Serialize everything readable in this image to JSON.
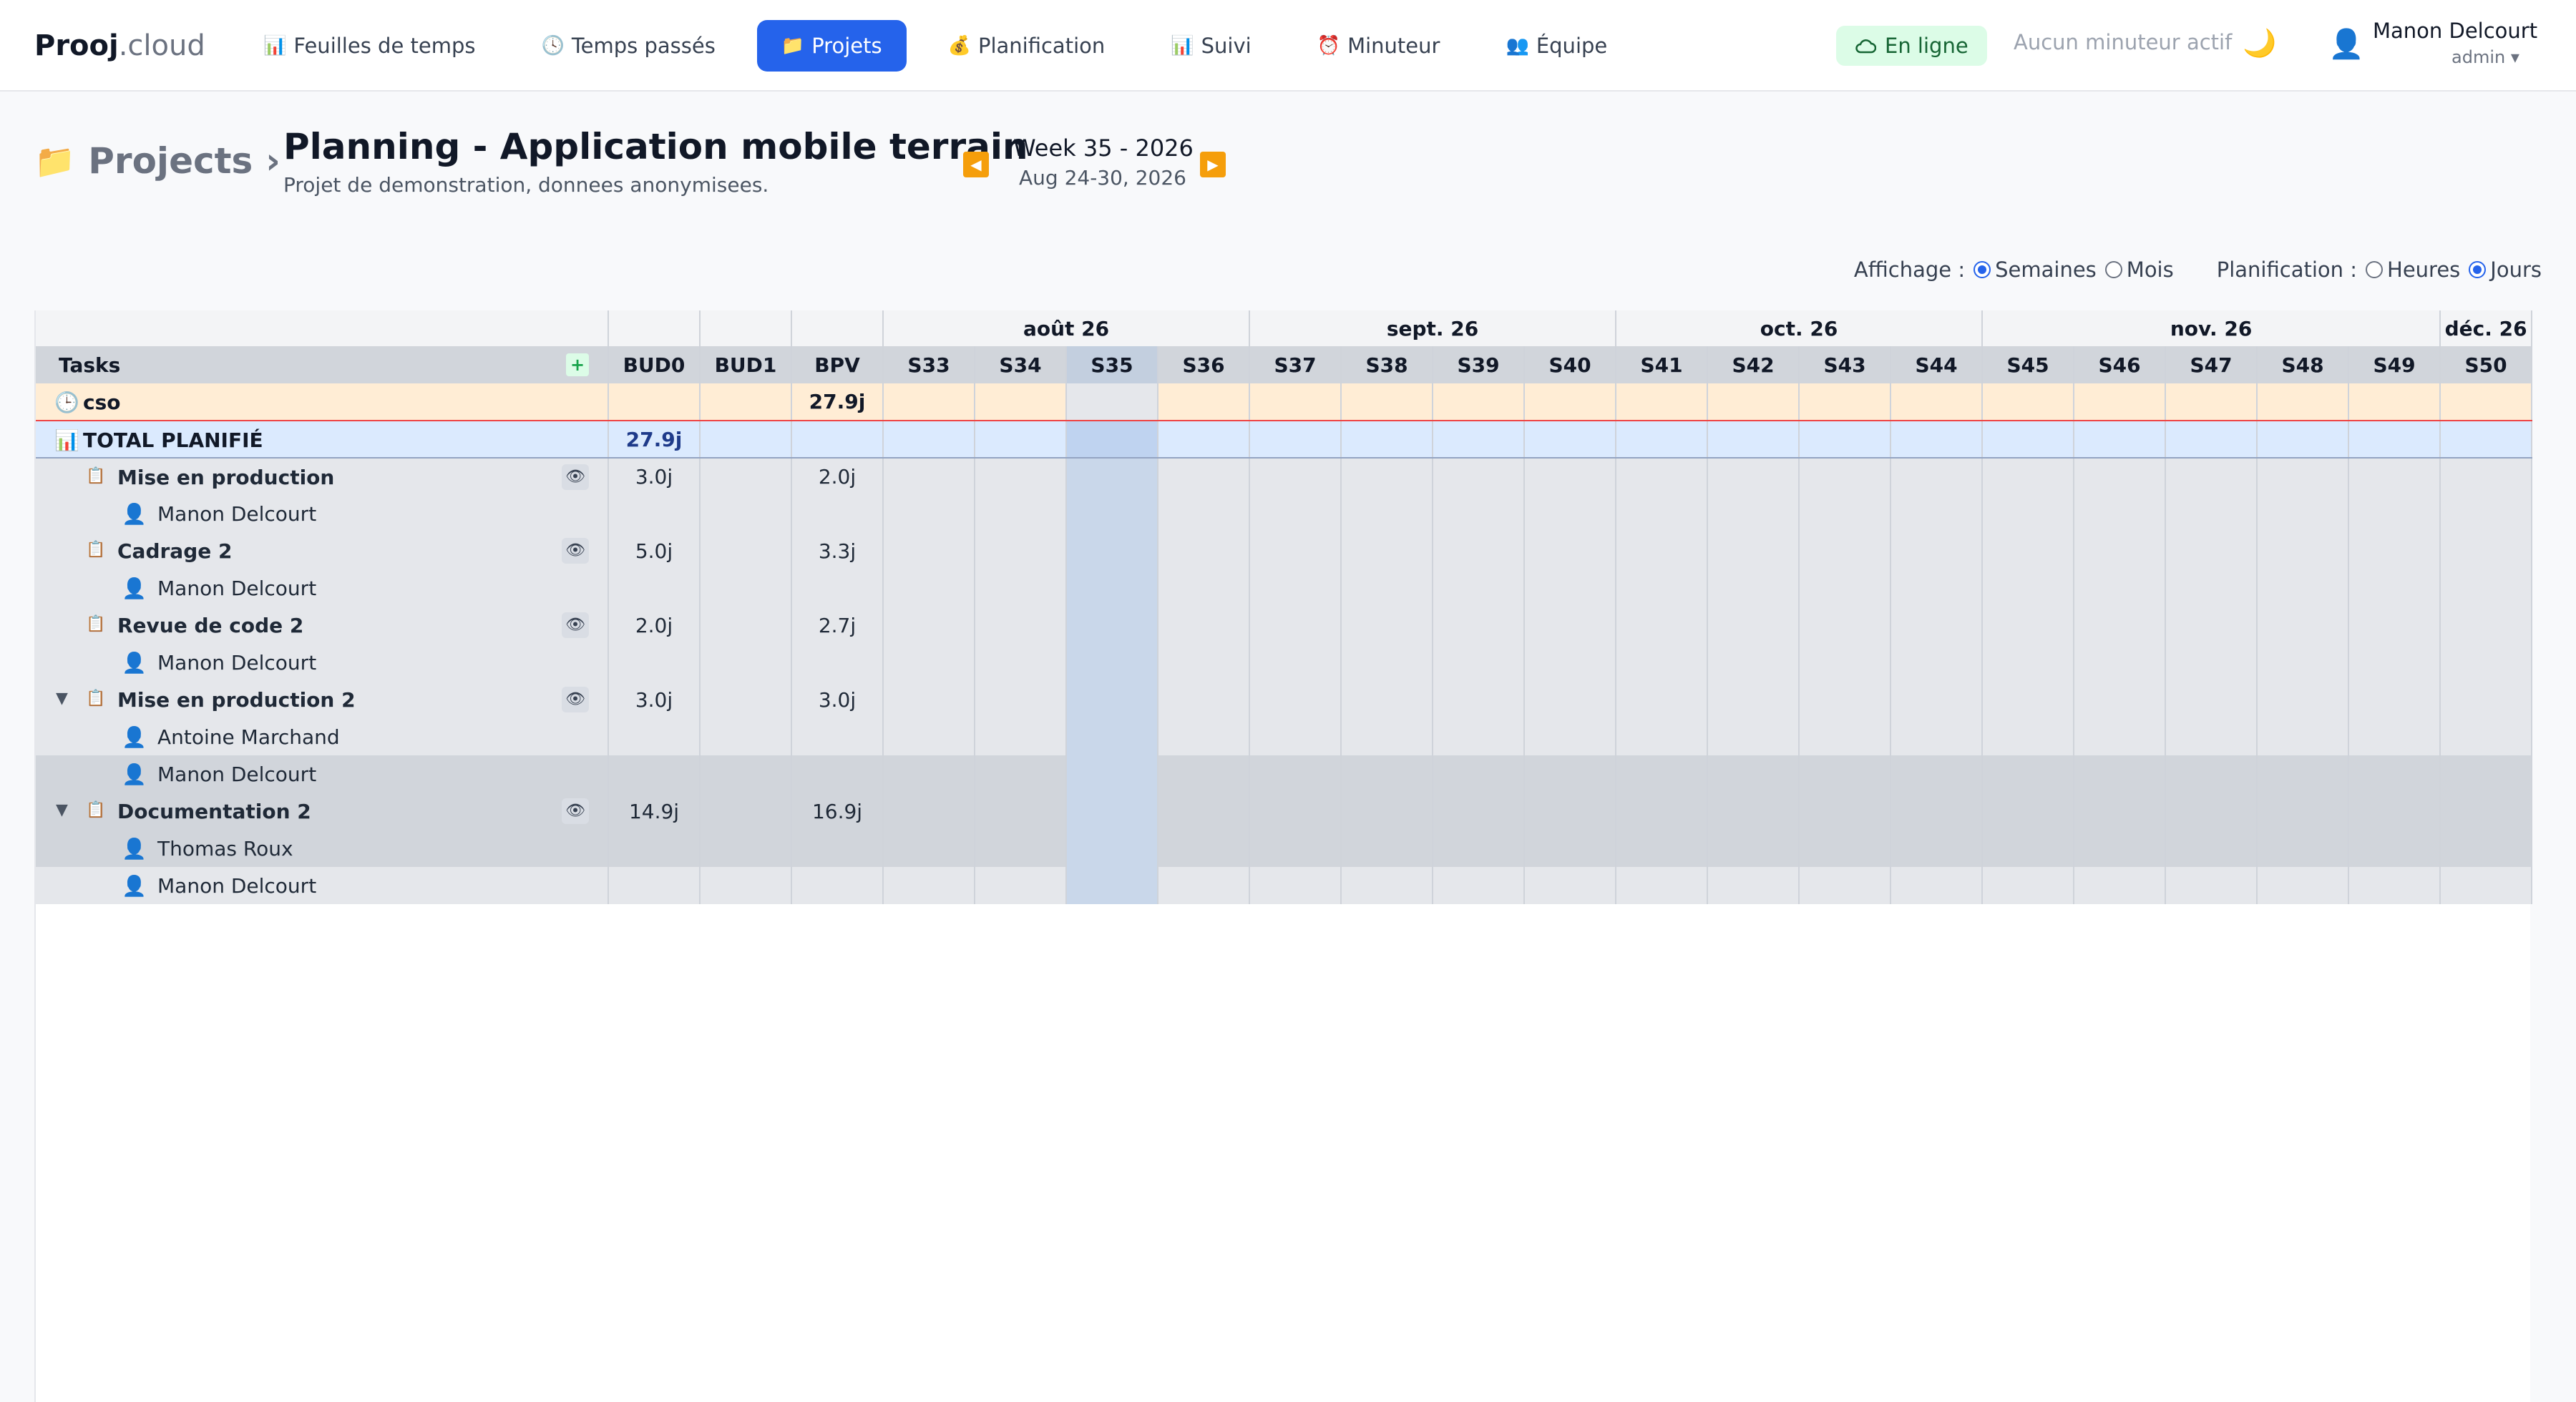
{
  "app": {
    "logo_bold": "Prooj",
    "logo_light": ".cloud"
  },
  "nav": [
    {
      "icon": "📊",
      "label": "Feuilles de temps",
      "active": false
    },
    {
      "icon": "🕓",
      "label": "Temps passés",
      "active": false
    },
    {
      "icon": "📁",
      "label": "Projets",
      "active": true
    },
    {
      "icon": "💰",
      "label": "Planification",
      "active": false
    },
    {
      "icon": "📊",
      "label": "Suivi",
      "active": false
    },
    {
      "icon": "⏰",
      "label": "Minuteur",
      "active": false
    },
    {
      "icon": "👥",
      "label": "Équipe",
      "active": false
    }
  ],
  "status": {
    "online": "En ligne",
    "timer": "Aucun minuteur actif"
  },
  "user": {
    "name": "Manon Delcourt",
    "role": "admin ▾"
  },
  "breadcrumb": {
    "root": "Projects",
    "sep": "›"
  },
  "project": {
    "title": "Planning - Application mobile terrain",
    "subtitle": "Projet de demonstration, donnees anonymisees."
  },
  "week": {
    "label": "Week 35 - 2026",
    "range": "Aug 24-30, 2026"
  },
  "options": {
    "display_label": "Affichage :",
    "weeks": "Semaines",
    "months": "Mois",
    "planning_label": "Planification :",
    "hours": "Heures",
    "days": "Jours"
  },
  "grid": {
    "tasks_header": "Tasks",
    "plus": "+",
    "cols": [
      "BUD0",
      "BUD1",
      "BPV"
    ],
    "months": [
      {
        "label": "août 26",
        "span": 4
      },
      {
        "label": "sept. 26",
        "span": 4
      },
      {
        "label": "oct. 26",
        "span": 4
      },
      {
        "label": "nov. 26",
        "span": 5
      },
      {
        "label": "déc. 26",
        "span": 1
      }
    ],
    "weeks": [
      "S33",
      "S34",
      "S35",
      "S36",
      "S37",
      "S38",
      "S39",
      "S40",
      "S41",
      "S42",
      "S43",
      "S44",
      "S45",
      "S46",
      "S47",
      "S48",
      "S49",
      "S50"
    ],
    "current_week": "S35",
    "cso": {
      "icon": "🕒",
      "label": "cso",
      "bud0": "",
      "bud1": "",
      "bpv": "27.9j"
    },
    "total": {
      "icon": "📊",
      "label": "TOTAL PLANIFIÉ",
      "bud0": "27.9j",
      "bud1": "",
      "bpv": ""
    },
    "rows": [
      {
        "type": "task",
        "toggle": "",
        "label": "Mise en production",
        "bud0": "3.0j",
        "bud1": "",
        "bpv": "2.0j"
      },
      {
        "type": "user",
        "label": "Manon Delcourt"
      },
      {
        "type": "task",
        "toggle": "",
        "label": "Cadrage 2",
        "bud0": "5.0j",
        "bud1": "",
        "bpv": "3.3j"
      },
      {
        "type": "user",
        "label": "Manon Delcourt"
      },
      {
        "type": "task",
        "toggle": "",
        "label": "Revue de code 2",
        "bud0": "2.0j",
        "bud1": "",
        "bpv": "2.7j"
      },
      {
        "type": "user",
        "label": "Manon Delcourt"
      },
      {
        "type": "task",
        "toggle": "▼",
        "label": "Mise en production 2",
        "bud0": "3.0j",
        "bud1": "",
        "bpv": "3.0j"
      },
      {
        "type": "user",
        "label": "Antoine Marchand"
      },
      {
        "type": "user",
        "label": "Manon Delcourt"
      },
      {
        "type": "task",
        "toggle": "▼",
        "label": "Documentation 2",
        "bud0": "14.9j",
        "bud1": "",
        "bpv": "16.9j"
      },
      {
        "type": "user",
        "label": "Thomas Roux"
      },
      {
        "type": "user",
        "label": "Manon Delcourt"
      }
    ]
  }
}
